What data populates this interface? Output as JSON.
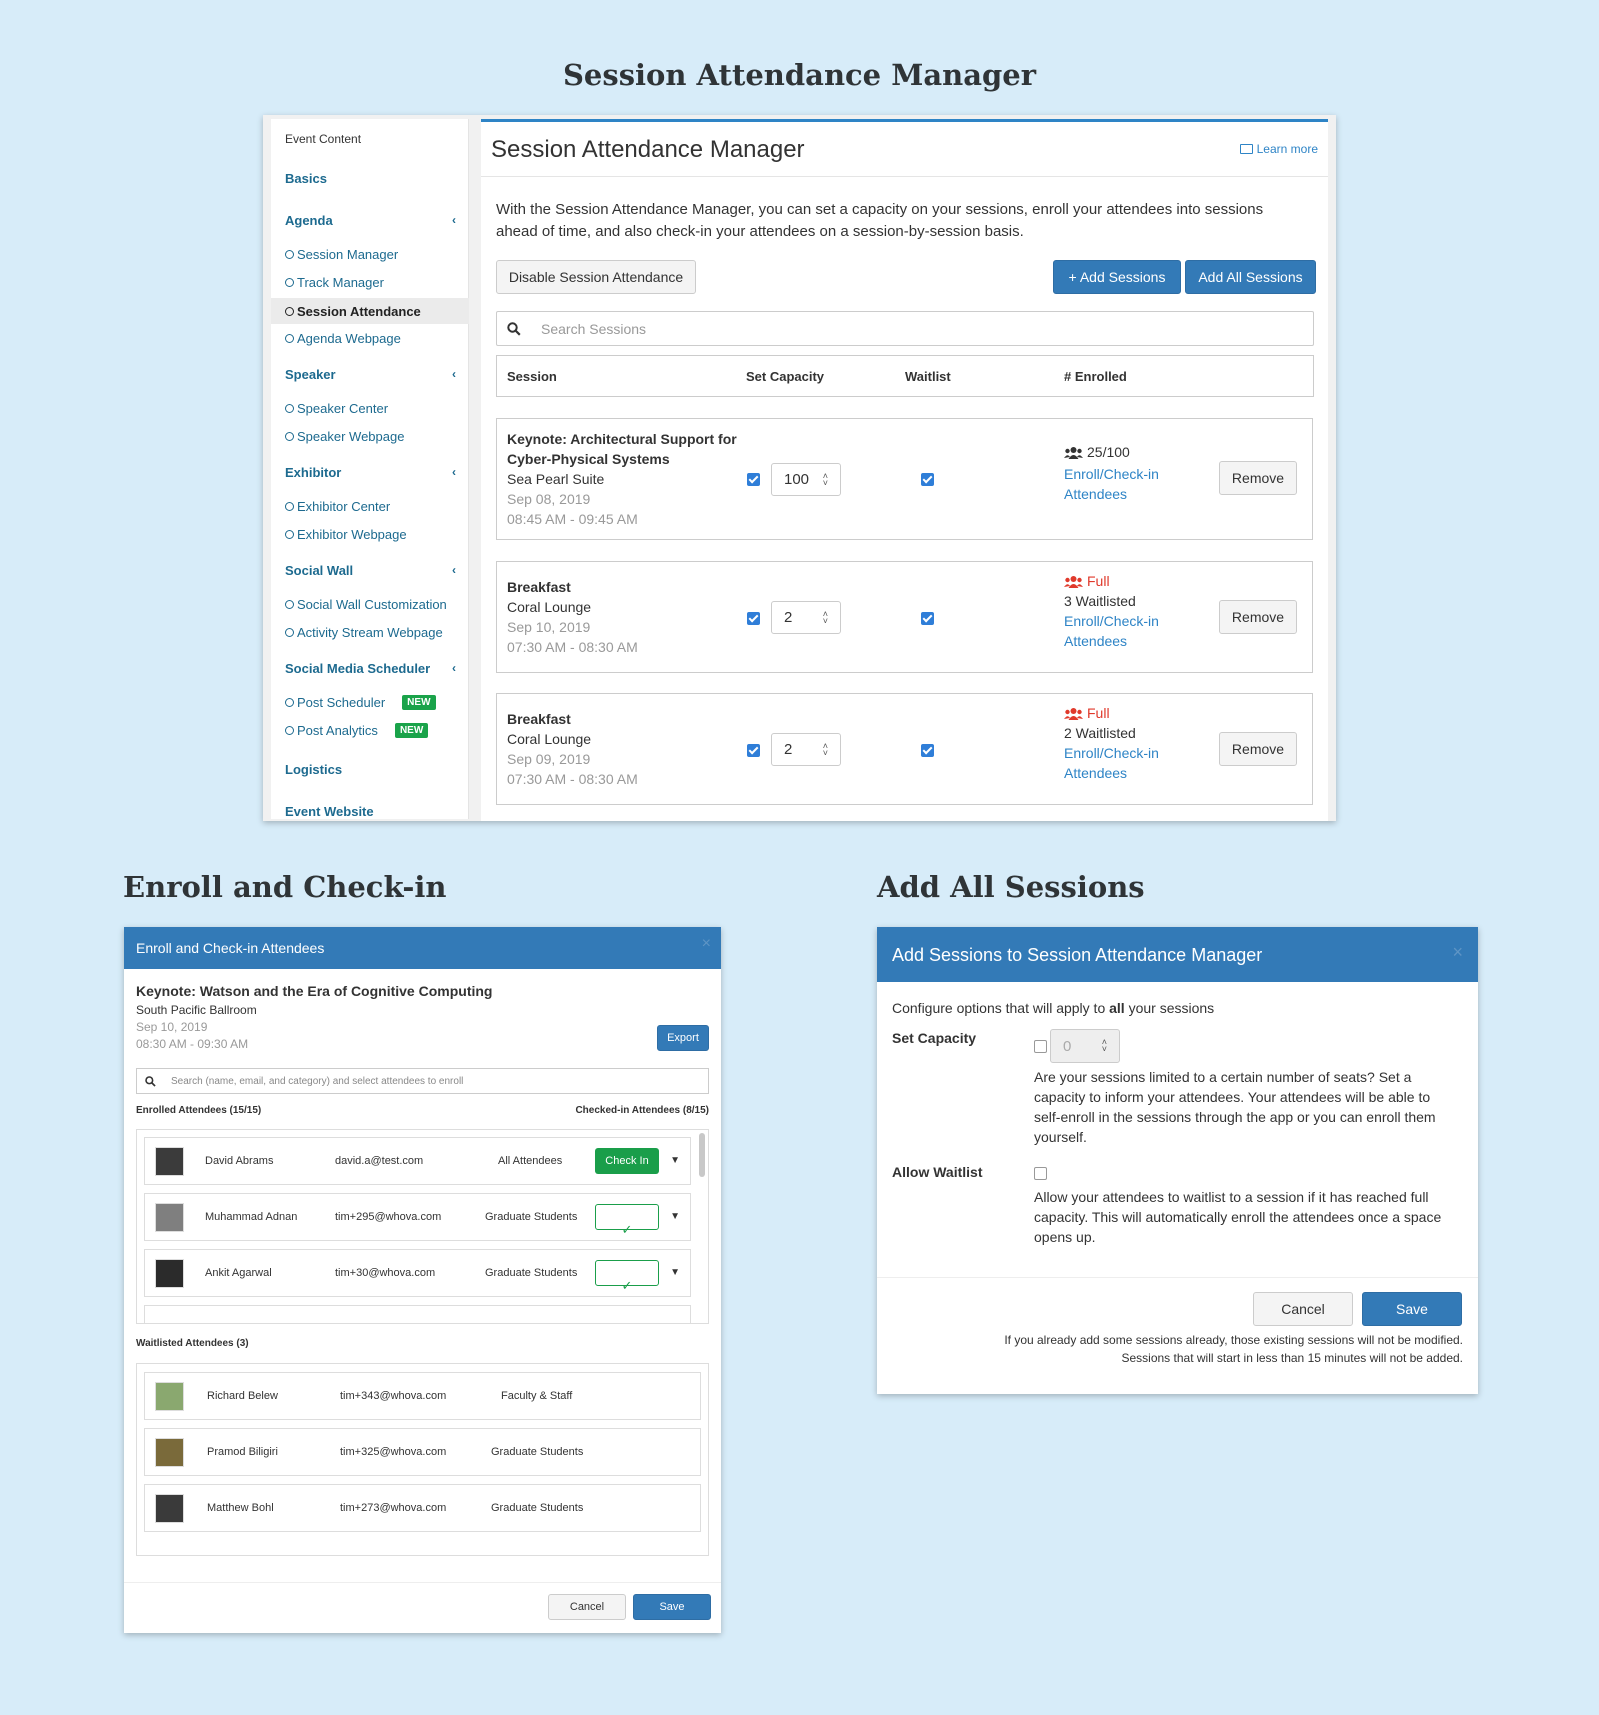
{
  "headings": {
    "main": "Session Attendance Manager",
    "enroll": "Enroll and Check-in",
    "add_all": "Add All Sessions"
  },
  "sidebar": {
    "top_label": "Event Content",
    "basics": "Basics",
    "agenda": "Agenda",
    "agenda_items": [
      "Session Manager",
      "Track Manager",
      "Session Attendance",
      "Agenda Webpage"
    ],
    "speaker": "Speaker",
    "speaker_items": [
      "Speaker Center",
      "Speaker Webpage"
    ],
    "exhibitor": "Exhibitor",
    "exhibitor_items": [
      "Exhibitor Center",
      "Exhibitor Webpage"
    ],
    "social_wall": "Social Wall",
    "social_wall_items": [
      "Social Wall Customization",
      "Activity Stream Webpage"
    ],
    "social_media": "Social Media Scheduler",
    "social_media_items": [
      "Post Scheduler",
      "Post Analytics"
    ],
    "new_badge": "NEW",
    "logistics": "Logistics",
    "event_website": "Event Website",
    "chevron": "‹"
  },
  "manager": {
    "title": "Session Attendance Manager",
    "learn_more": "Learn more",
    "description": "With the Session Attendance Manager, you can set a capacity on your sessions, enroll your attendees into sessions ahead of time, and also check-in your attendees on a session-by-session basis.",
    "disable_btn": "Disable Session Attendance",
    "add_sessions_btn": "+ Add Sessions",
    "add_all_btn": "Add All Sessions",
    "search_placeholder": "Search Sessions",
    "columns": [
      "Session",
      "Set Capacity",
      "Waitlist",
      "# Enrolled"
    ],
    "enroll_link_1": "Enroll/Check-in",
    "enroll_link_2": "Attendees",
    "remove_btn": "Remove",
    "sessions": [
      {
        "title1": "Keynote: Architectural Support for",
        "title2": "Cyber-Physical Systems",
        "location": "Sea Pearl Suite",
        "date": "Sep 08, 2019",
        "time": "08:45 AM - 09:45 AM",
        "capacity": "100",
        "enrolled": "25/100"
      },
      {
        "title1": "Breakfast",
        "location": "Coral Lounge",
        "date": "Sep 10, 2019",
        "time": "07:30 AM - 08:30 AM",
        "capacity": "2",
        "status": "Full",
        "waitlisted": "3 Waitlisted"
      },
      {
        "title1": "Breakfast",
        "location": "Coral Lounge",
        "date": "Sep 09, 2019",
        "time": "07:30 AM - 08:30 AM",
        "capacity": "2",
        "status": "Full",
        "waitlisted": "2 Waitlisted"
      }
    ]
  },
  "enroll_modal": {
    "header": "Enroll and Check-in Attendees",
    "close": "×",
    "session_title": "Keynote: Watson and the Era of Cognitive Computing",
    "location": "South Pacific Ballroom",
    "date": "Sep 10, 2019",
    "time": "08:30 AM - 09:30 AM",
    "export_btn": "Export",
    "search_placeholder": "Search (name, email, and category) and select attendees to enroll",
    "enrolled_label": "Enrolled Attendees (15/15)",
    "checked_label": "Checked-in Attendees (8/15)",
    "check_in_btn": "Check In",
    "enrolled": [
      {
        "name": "David Abrams",
        "email": "david.a@test.com",
        "category": "All Attendees"
      },
      {
        "name": "Muhammad Adnan",
        "email": "tim+295@whova.com",
        "category": "Graduate Students"
      },
      {
        "name": "Ankit Agarwal",
        "email": "tim+30@whova.com",
        "category": "Graduate Students"
      }
    ],
    "waitlisted_label": "Waitlisted Attendees (3)",
    "waitlisted": [
      {
        "name": "Richard Belew",
        "email": "tim+343@whova.com",
        "category": "Faculty & Staff"
      },
      {
        "name": "Pramod Biligiri",
        "email": "tim+325@whova.com",
        "category": "Graduate Students"
      },
      {
        "name": "Matthew Bohl",
        "email": "tim+273@whova.com",
        "category": "Graduate Students"
      }
    ],
    "cancel_btn": "Cancel",
    "save_btn": "Save"
  },
  "add_modal": {
    "header": "Add Sessions to Session Attendance Manager",
    "close": "×",
    "intro_pre": "Configure options that will apply to ",
    "intro_bold": "all",
    "intro_post": " your sessions",
    "set_capacity_label": "Set Capacity",
    "capacity_value": "0",
    "capacity_desc": "Are your sessions limited to a certain number of seats? Set a capacity to inform your attendees. Your attendees will be able to self-enroll in the sessions through the app or you can enroll them yourself.",
    "allow_waitlist_label": "Allow Waitlist",
    "waitlist_desc": "Allow your attendees to waitlist to a session if it has reached full capacity. This will automatically enroll the attendees once a space opens up.",
    "cancel_btn": "Cancel",
    "save_btn": "Save",
    "note1": "If you already add some sessions already, those existing sessions will not be modified.",
    "note2": "Sessions that will start in less than 15 minutes will not be added."
  }
}
